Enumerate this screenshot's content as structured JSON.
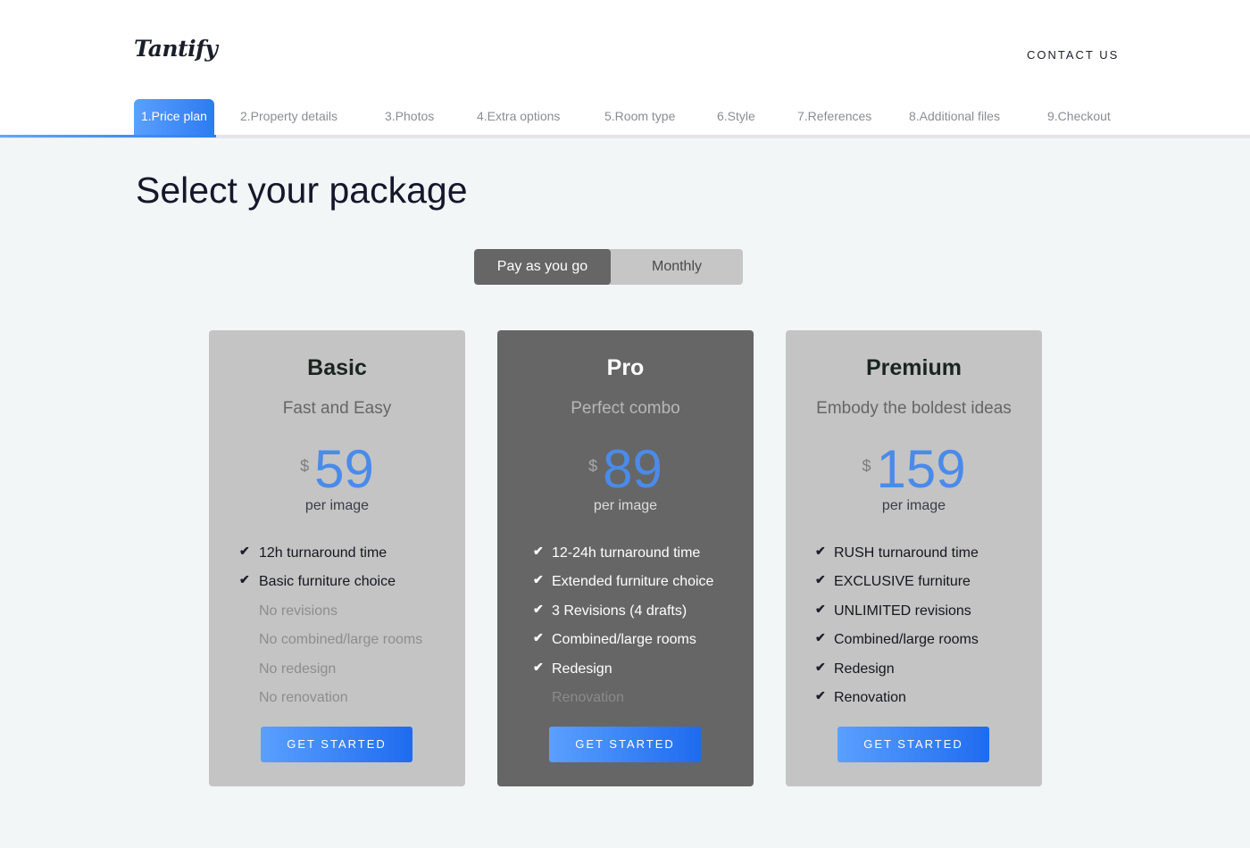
{
  "brand": {
    "logo_text": "Tantify"
  },
  "nav": {
    "contact_label": "CONTACT US"
  },
  "steps": [
    {
      "label": "1.Price plan",
      "active": true
    },
    {
      "label": "2.Property details",
      "active": false
    },
    {
      "label": "3.Photos",
      "active": false
    },
    {
      "label": "4.Extra options",
      "active": false
    },
    {
      "label": "5.Room type",
      "active": false
    },
    {
      "label": "6.Style",
      "active": false
    },
    {
      "label": "7.References",
      "active": false
    },
    {
      "label": "8.Additional files",
      "active": false
    },
    {
      "label": "9.Checkout",
      "active": false
    }
  ],
  "page": {
    "title": "Select your package"
  },
  "billing_toggle": {
    "options": [
      "Pay as you go",
      "Monthly"
    ],
    "selected": "Pay as you go"
  },
  "colors": {
    "accent": "#3d86f4",
    "price": "#4a8bea",
    "card_light": "#c4c4c4",
    "card_dark": "#666666"
  },
  "plans": [
    {
      "name": "Basic",
      "tagline": "Fast and Easy",
      "currency": "$",
      "price": "59",
      "unit": "per image",
      "cta": "GET STARTED",
      "features": [
        {
          "text": "12h turnaround time",
          "included": true
        },
        {
          "text": "Basic furniture choice",
          "included": true
        },
        {
          "text": "No revisions",
          "included": false
        },
        {
          "text": "No combined/large rooms",
          "included": false
        },
        {
          "text": "No redesign",
          "included": false
        },
        {
          "text": "No renovation",
          "included": false
        }
      ]
    },
    {
      "name": "Pro",
      "tagline": "Perfect combo",
      "currency": "$",
      "price": "89",
      "unit": "per image",
      "cta": "GET STARTED",
      "features": [
        {
          "text": "12-24h turnaround time",
          "included": true
        },
        {
          "text": "Extended furniture choice",
          "included": true
        },
        {
          "text": "3 Revisions (4 drafts)",
          "included": true
        },
        {
          "text": "Combined/large rooms",
          "included": true
        },
        {
          "text": "Redesign",
          "included": true
        },
        {
          "text": "Renovation",
          "included": false
        }
      ]
    },
    {
      "name": "Premium",
      "tagline": "Embody the boldest ideas",
      "currency": "$",
      "price": "159",
      "unit": "per image",
      "cta": "GET STARTED",
      "features": [
        {
          "text": "RUSH turnaround time",
          "included": true
        },
        {
          "text": "EXCLUSIVE furniture",
          "included": true
        },
        {
          "text": "UNLIMITED revisions",
          "included": true
        },
        {
          "text": "Combined/large rooms",
          "included": true
        },
        {
          "text": "Redesign",
          "included": true
        },
        {
          "text": "Renovation",
          "included": true
        }
      ]
    }
  ]
}
